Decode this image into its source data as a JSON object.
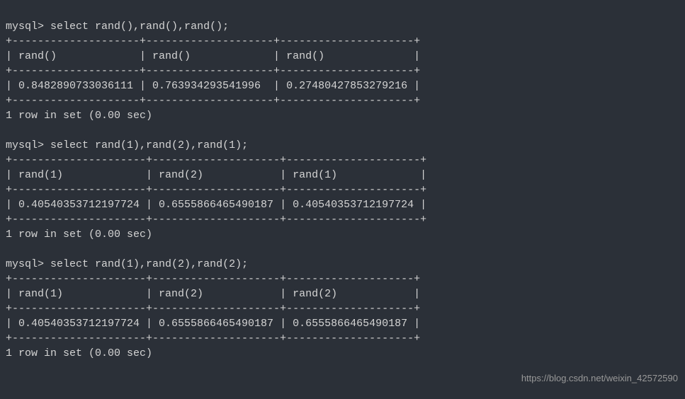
{
  "prompt": "mysql>",
  "queries": [
    {
      "command": "select rand(),rand(),rand();",
      "separator": "+--------------------+--------------------+---------------------+",
      "header": "| rand()             | rand()             | rand()              |",
      "data_row": "| 0.8482890733036111 | 0.763934293541996  | 0.27480427853279216 |",
      "footer": "1 row in set (0.00 sec)"
    },
    {
      "command": "select rand(1),rand(2),rand(1);",
      "separator": "+---------------------+--------------------+---------------------+",
      "header": "| rand(1)             | rand(2)            | rand(1)             |",
      "data_row": "| 0.40540353712197724 | 0.6555866465490187 | 0.40540353712197724 |",
      "footer": "1 row in set (0.00 sec)"
    },
    {
      "command": "select rand(1),rand(2),rand(2);",
      "separator": "+---------------------+--------------------+--------------------+",
      "header": "| rand(1)             | rand(2)            | rand(2)            |",
      "data_row": "| 0.40540353712197724 | 0.6555866465490187 | 0.6555866465490187 |",
      "footer": "1 row in set (0.00 sec)"
    }
  ],
  "chart_data": [
    {
      "type": "table",
      "title": "select rand(),rand(),rand()",
      "columns": [
        "rand()",
        "rand()",
        "rand()"
      ],
      "rows": [
        [
          0.8482890733036111,
          0.763934293541996,
          0.27480427853279216
        ]
      ]
    },
    {
      "type": "table",
      "title": "select rand(1),rand(2),rand(1)",
      "columns": [
        "rand(1)",
        "rand(2)",
        "rand(1)"
      ],
      "rows": [
        [
          0.40540353712197724,
          0.6555866465490187,
          0.40540353712197724
        ]
      ]
    },
    {
      "type": "table",
      "title": "select rand(1),rand(2),rand(2)",
      "columns": [
        "rand(1)",
        "rand(2)",
        "rand(2)"
      ],
      "rows": [
        [
          0.40540353712197724,
          0.6555866465490187,
          0.6555866465490187
        ]
      ]
    }
  ],
  "watermark": "https://blog.csdn.net/weixin_42572590"
}
